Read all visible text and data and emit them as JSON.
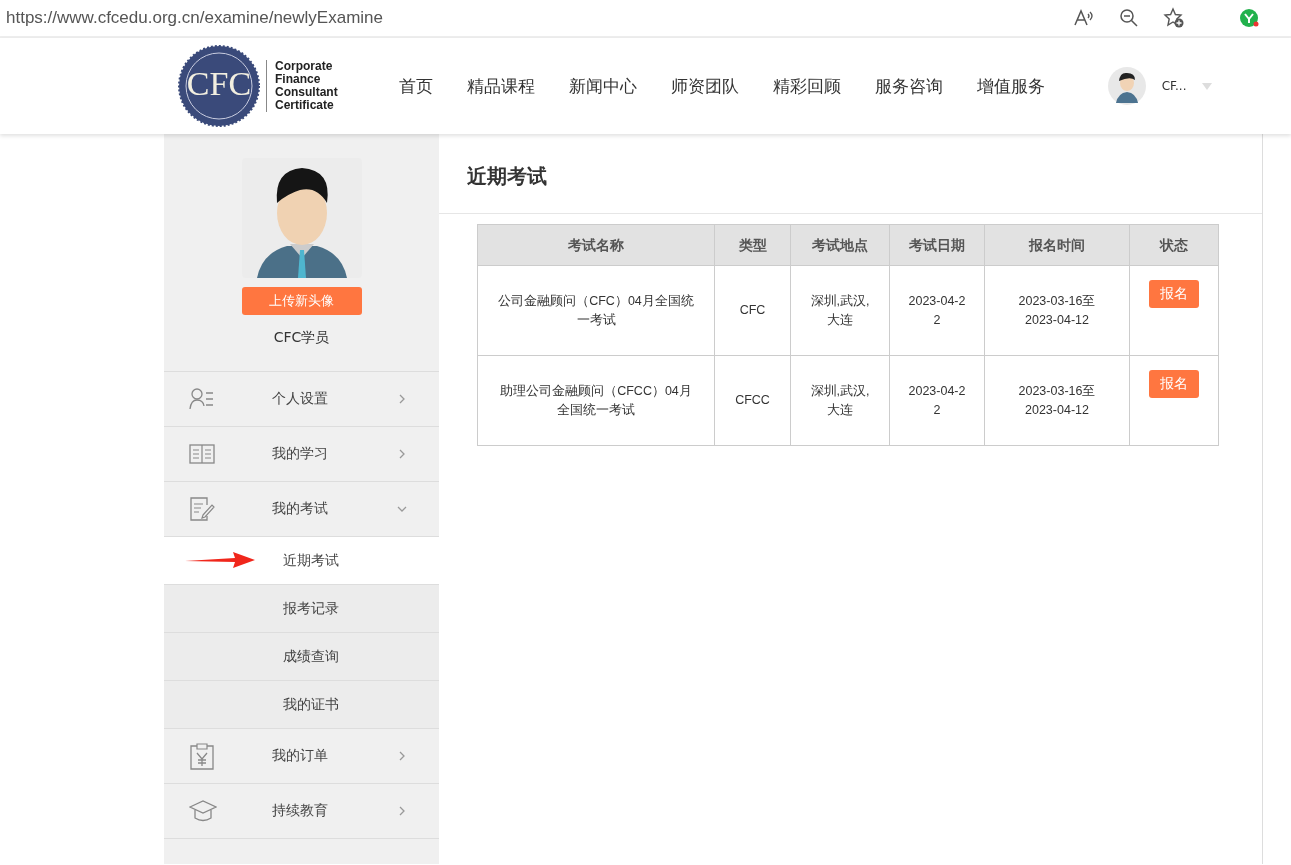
{
  "browser": {
    "url": "https://www.cfcedu.org.cn/examine/newlyExamine"
  },
  "header": {
    "logo_mark": "CFC",
    "logo_text": [
      "Corporate",
      "Finance",
      "Consultant",
      "Certificate"
    ],
    "nav": [
      {
        "label": "首页",
        "selected": false
      },
      {
        "label": "精品课程",
        "selected": false
      },
      {
        "label": "新闻中心",
        "selected": false
      },
      {
        "label": "师资团队",
        "selected": false
      },
      {
        "label": "精彩回顾",
        "selected": false
      },
      {
        "label": "服务咨询",
        "selected": false
      },
      {
        "label": "增值服务",
        "selected": false
      }
    ],
    "user": "CF..."
  },
  "sidebar": {
    "upload_button": "上传新头像",
    "username": "CFC学员",
    "items": [
      {
        "kind": "person",
        "label": "个人设置",
        "expanded": false
      },
      {
        "kind": "book",
        "label": "我的学习",
        "expanded": false
      },
      {
        "kind": "exam",
        "label": "我的考试",
        "expanded": true,
        "children": [
          {
            "label": "近期考试",
            "selected": true
          },
          {
            "label": "报考记录",
            "selected": false
          },
          {
            "label": "成绩查询",
            "selected": false
          },
          {
            "label": "我的证书",
            "selected": false
          }
        ]
      },
      {
        "kind": "order",
        "label": "我的订单",
        "expanded": false
      },
      {
        "kind": "education",
        "label": "持续教育",
        "expanded": false
      }
    ]
  },
  "main": {
    "title": "近期考试",
    "table": {
      "columns": [
        "考试名称",
        "类型",
        "考试地点",
        "考试日期",
        "报名时间",
        "状态"
      ],
      "rows": [
        {
          "name": "公司金融顾问（CFC）04月全国统一考试",
          "type": "CFC",
          "location": "深圳,武汉,大连",
          "date": "2023-04-22",
          "period": "2023-03-16至2023-04-12",
          "action": "报名"
        },
        {
          "name": "助理公司金融顾问（CFCC）04月全国统一考试",
          "type": "CFCC",
          "location": "深圳,武汉,大连",
          "date": "2023-04-22",
          "period": "2023-03-16至2023-04-12",
          "action": "报名"
        }
      ]
    }
  }
}
